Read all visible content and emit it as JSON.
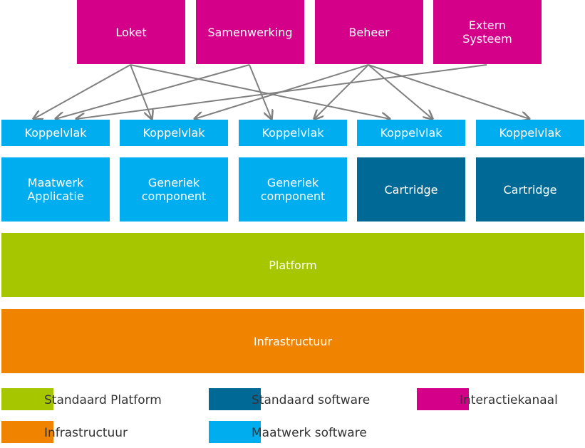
{
  "channels": [
    "Loket",
    "Samenwerking",
    "Beheer",
    "Extern\nSysteem"
  ],
  "interfaces": [
    "Koppelvlak",
    "Koppelvlak",
    "Koppelvlak",
    "Koppelvlak",
    "Koppelvlak"
  ],
  "components": [
    {
      "label": "Maatwerk\nApplicatie",
      "kind": "maatwerk"
    },
    {
      "label": "Generiek\ncomponent",
      "kind": "maatwerk"
    },
    {
      "label": "Generiek\ncomponent",
      "kind": "maatwerk"
    },
    {
      "label": "Cartridge",
      "kind": "standaard"
    },
    {
      "label": "Cartridge",
      "kind": "standaard"
    }
  ],
  "platform": "Platform",
  "infrastructure": "Infrastructuur",
  "connections": [
    [
      "Loket",
      1
    ],
    [
      "Loket",
      2
    ],
    [
      "Loket",
      4
    ],
    [
      "Samenwerking",
      1
    ],
    [
      "Samenwerking",
      3
    ],
    [
      "Beheer",
      2
    ],
    [
      "Beheer",
      3
    ],
    [
      "Beheer",
      4
    ],
    [
      "Beheer",
      5
    ],
    [
      "Extern Systeem",
      1
    ]
  ],
  "legend": [
    "Standaard Platform",
    "Standaard software",
    "Interactiekanaal",
    "Infrastructuur",
    "Maatwerk software"
  ],
  "colors": {
    "interactie": "#d5008a",
    "maatwerk": "#00adef",
    "standaard": "#006996",
    "platform": "#a6c600",
    "infra": "#f08300",
    "arrow": "#808080"
  }
}
